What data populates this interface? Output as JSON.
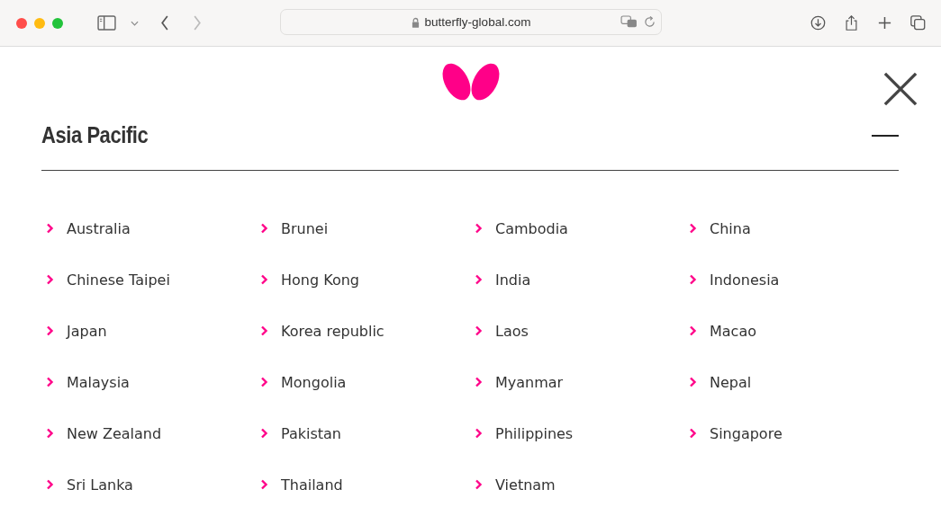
{
  "browser": {
    "url": "butterfly-global.com"
  },
  "region": {
    "title": "Asia Pacific",
    "expanded": true,
    "countries": [
      "Australia",
      "Brunei",
      "Cambodia",
      "China",
      "Chinese Taipei",
      "Hong Kong",
      "India",
      "Indonesia",
      "Japan",
      "Korea republic",
      "Laos",
      "Macao",
      "Malaysia",
      "Mongolia",
      "Myanmar",
      "Nepal",
      "New Zealand",
      "Pakistan",
      "Philippines",
      "Singapore",
      "Sri Lanka",
      "Thailand",
      "Vietnam"
    ]
  }
}
